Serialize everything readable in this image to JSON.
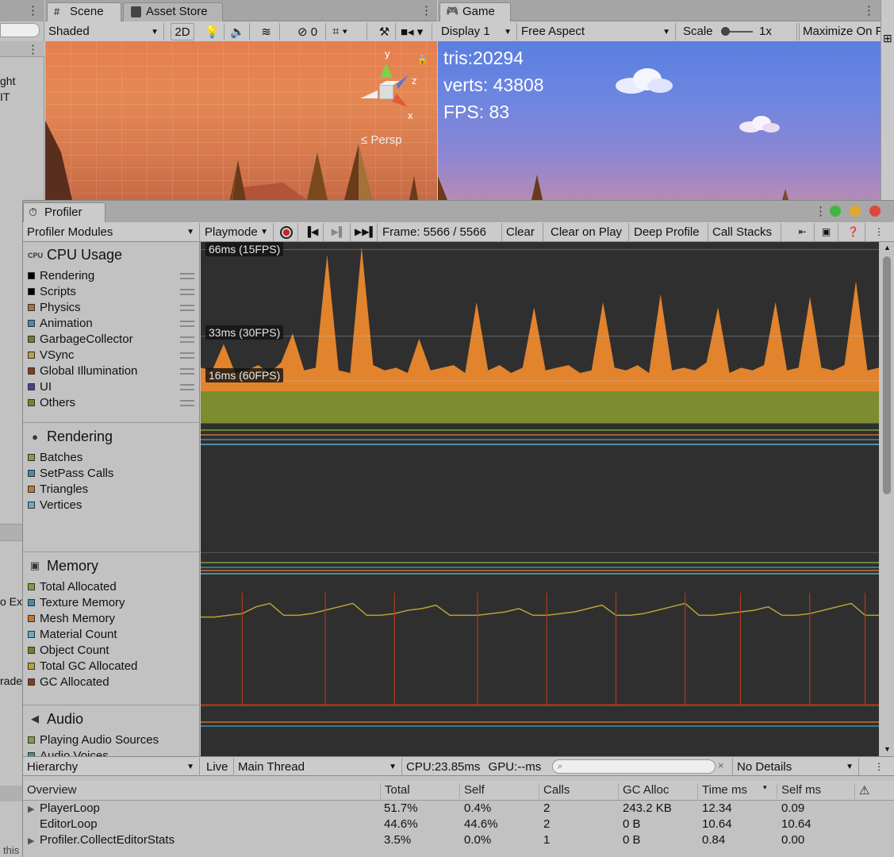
{
  "scene_tabs": {
    "scene_label": "Scene",
    "asset_store_label": "Asset Store",
    "shading_mode": "Shaded",
    "mode_2d": "2D",
    "hidden_count": "0",
    "persp_label": "Persp",
    "gizmo_axes": {
      "y": "y",
      "z": "z",
      "x": "x"
    }
  },
  "left_panel": {
    "fragments": [
      "ght",
      "IT",
      "o Ext",
      "rade",
      "this"
    ]
  },
  "game": {
    "tab_label": "Game",
    "display": "Display 1",
    "aspect": "Free Aspect",
    "scale_label": "Scale",
    "scale_value": "1x",
    "maximize": "Maximize On P",
    "tris": "tris:20294",
    "verts": "verts: 43808",
    "fps": "FPS: 83"
  },
  "profiler": {
    "tab_label": "Profiler",
    "modules_dropdown": "Profiler Modules",
    "playmode_dropdown": "Playmode",
    "frame_label": "Frame: 5566 / 5566",
    "clear": "Clear",
    "clear_on_play": "Clear on Play",
    "deep_profile": "Deep Profile",
    "call_stacks": "Call Stacks"
  },
  "modules": {
    "cpu": {
      "title": "CPU Usage",
      "icon_text": "CPU",
      "items": [
        {
          "label": "Rendering",
          "color": "#000000"
        },
        {
          "label": "Scripts",
          "color": "#000000"
        },
        {
          "label": "Physics",
          "color": "#b07237"
        },
        {
          "label": "Animation",
          "color": "#3e8fa8"
        },
        {
          "label": "GarbageCollector",
          "color": "#7c7a22"
        },
        {
          "label": "VSync",
          "color": "#b8a337"
        },
        {
          "label": "Global Illumination",
          "color": "#8a3a1c"
        },
        {
          "label": "UI",
          "color": "#4b3f96"
        },
        {
          "label": "Others",
          "color": "#6f8a27"
        }
      ]
    },
    "rendering": {
      "title": "Rendering",
      "items": [
        {
          "label": "Batches",
          "color": "#7ba33a"
        },
        {
          "label": "SetPass Calls",
          "color": "#3e8fa8"
        },
        {
          "label": "Triangles",
          "color": "#c7742b"
        },
        {
          "label": "Vertices",
          "color": "#5fb0c0"
        }
      ]
    },
    "memory": {
      "title": "Memory",
      "items": [
        {
          "label": "Total Allocated",
          "color": "#7ba33a"
        },
        {
          "label": "Texture Memory",
          "color": "#3e8fa8"
        },
        {
          "label": "Mesh Memory",
          "color": "#c7742b"
        },
        {
          "label": "Material Count",
          "color": "#5fb0c0"
        },
        {
          "label": "Object Count",
          "color": "#7c7a22"
        },
        {
          "label": "Total GC Allocated",
          "color": "#b8a337"
        },
        {
          "label": "GC Allocated",
          "color": "#8a3a1c"
        }
      ]
    },
    "audio": {
      "title": "Audio",
      "items": [
        {
          "label": "Playing Audio Sources",
          "color": "#7ba33a"
        },
        {
          "label": "Audio Voices",
          "color": "#3e8fa8"
        }
      ]
    }
  },
  "cpu_chart": {
    "fps_lines": [
      "66ms (15FPS)",
      "33ms (30FPS)",
      "16ms (60FPS)"
    ]
  },
  "chart_data": [
    {
      "type": "area",
      "title": "CPU Usage",
      "ylabel": "",
      "ylim": [
        0,
        67
      ],
      "reference_lines": [
        {
          "label": "66ms (15FPS)",
          "value": 66
        },
        {
          "label": "33ms (30FPS)",
          "value": 33
        },
        {
          "label": "16ms (60FPS)",
          "value": 16
        }
      ],
      "series": [
        {
          "name": "Others",
          "color": "#7c8c2e",
          "values": [
            12,
            12,
            12,
            12,
            12,
            12,
            12,
            12,
            12,
            12,
            12,
            12,
            12,
            12,
            12,
            12,
            12,
            12,
            12,
            12,
            12,
            12,
            12,
            12,
            12,
            12,
            12,
            12,
            12,
            12,
            12,
            12,
            12,
            12,
            12,
            12,
            12,
            12,
            12,
            12,
            12,
            12,
            12,
            12,
            12,
            12,
            12,
            12,
            12,
            12,
            12,
            12,
            12,
            12,
            12,
            12,
            12,
            12,
            12,
            12
          ]
        },
        {
          "name": "Scripts",
          "color": "#e2832d",
          "values": [
            21,
            20,
            30,
            19,
            20,
            22,
            19,
            23,
            34,
            20,
            21,
            64,
            20,
            19,
            67,
            22,
            20,
            21,
            19,
            32,
            20,
            21,
            22,
            19,
            46,
            20,
            22,
            19,
            21,
            44,
            20,
            21,
            22,
            19,
            20,
            46,
            21,
            20,
            22,
            19,
            49,
            20,
            21,
            20,
            23,
            44,
            19,
            21,
            20,
            22,
            46,
            20,
            21,
            48,
            21,
            20,
            22,
            54,
            20,
            21
          ]
        }
      ]
    },
    {
      "type": "line",
      "title": "Memory",
      "series": [
        {
          "name": "Total GC Allocated",
          "color": "#b8a337",
          "values": [
            52,
            52,
            53,
            54,
            58,
            60,
            53,
            53,
            54,
            56,
            58,
            60,
            53,
            53,
            54,
            56,
            57,
            59,
            53,
            53,
            53,
            54,
            55,
            57,
            53,
            53,
            54,
            55,
            57,
            59,
            53,
            53,
            54,
            56,
            58,
            60,
            53,
            53,
            54,
            55,
            56,
            58,
            53,
            53,
            54,
            56,
            58,
            60,
            53,
            53
          ]
        },
        {
          "name": "GC Allocated",
          "color": "#b03a18",
          "values": [
            0,
            0,
            0,
            8,
            0,
            0,
            0,
            0,
            0,
            8,
            0,
            0,
            0,
            0,
            8,
            0,
            0,
            0,
            0,
            0,
            8,
            0,
            0,
            0,
            0,
            8,
            0,
            0,
            0,
            0,
            8,
            0,
            0,
            0,
            0,
            8,
            0,
            0,
            0,
            8,
            0,
            0,
            0,
            0,
            8,
            0,
            0,
            0,
            8,
            0
          ]
        }
      ]
    }
  ],
  "hierarchy": {
    "view_dropdown": "Hierarchy",
    "live_label": "Live",
    "thread_dropdown": "Main Thread",
    "cpu_time": "CPU:23.85ms",
    "gpu_time": "GPU:--ms",
    "details_dropdown": "No Details",
    "columns": [
      "Overview",
      "Total",
      "Self",
      "Calls",
      "GC Alloc",
      "Time ms",
      "Self ms"
    ],
    "rows": [
      {
        "name": "PlayerLoop",
        "expandable": true,
        "total": "51.7%",
        "self": "0.4%",
        "calls": "2",
        "gc": "243.2 KB",
        "time": "12.34",
        "selfms": "0.09"
      },
      {
        "name": "EditorLoop",
        "expandable": false,
        "total": "44.6%",
        "self": "44.6%",
        "calls": "2",
        "gc": "0 B",
        "time": "10.64",
        "selfms": "10.64"
      },
      {
        "name": "Profiler.CollectEditorStats",
        "expandable": true,
        "total": "3.5%",
        "self": "0.0%",
        "calls": "1",
        "gc": "0 B",
        "time": "0.84",
        "selfms": "0.00"
      }
    ]
  }
}
